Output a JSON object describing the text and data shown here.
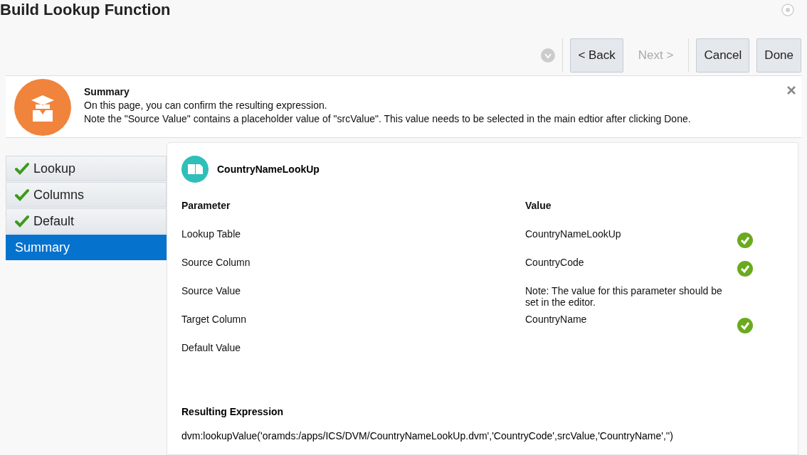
{
  "title": "Build Lookup Function",
  "toolbar": {
    "buttons": [
      {
        "label": "< Back",
        "disabled": false
      },
      {
        "label": "Next >",
        "disabled": true
      }
    ],
    "actions": [
      {
        "label": "Cancel",
        "disabled": false
      },
      {
        "label": "Done",
        "disabled": false
      }
    ]
  },
  "banner": {
    "heading": "Summary",
    "lines": [
      "On this page, you can confirm the resulting expression.",
      "Note the \"Source Value\" contains a placeholder value of \"srcValue\". This value needs to be selected in the main edtior after clicking Done."
    ]
  },
  "steps": [
    {
      "label": "Lookup",
      "completed": true,
      "selected": false
    },
    {
      "label": "Columns",
      "completed": true,
      "selected": false
    },
    {
      "label": "Default",
      "completed": true,
      "selected": false
    },
    {
      "label": "Summary",
      "completed": false,
      "selected": true
    }
  ],
  "panel": {
    "name": "CountryNameLookUp",
    "columns": [
      "Parameter",
      "Value"
    ],
    "rows": [
      {
        "parameter": "Lookup Table",
        "value": "CountryNameLookUp",
        "valid": true
      },
      {
        "parameter": "Source Column",
        "value": "CountryCode",
        "valid": true
      },
      {
        "parameter": "Source Value",
        "value": "Note: The value for this parameter should be set in the editor.",
        "valid": false
      },
      {
        "parameter": "Target Column",
        "value": "CountryName",
        "valid": true
      },
      {
        "parameter": "Default Value",
        "value": "",
        "valid": false
      }
    ],
    "expression_label": "Resulting Expression",
    "expression": "dvm:lookupValue('oramds:/apps/ICS/DVM/CountryNameLookUp.dvm','CountryCode',srcValue,'CountryName','')"
  }
}
